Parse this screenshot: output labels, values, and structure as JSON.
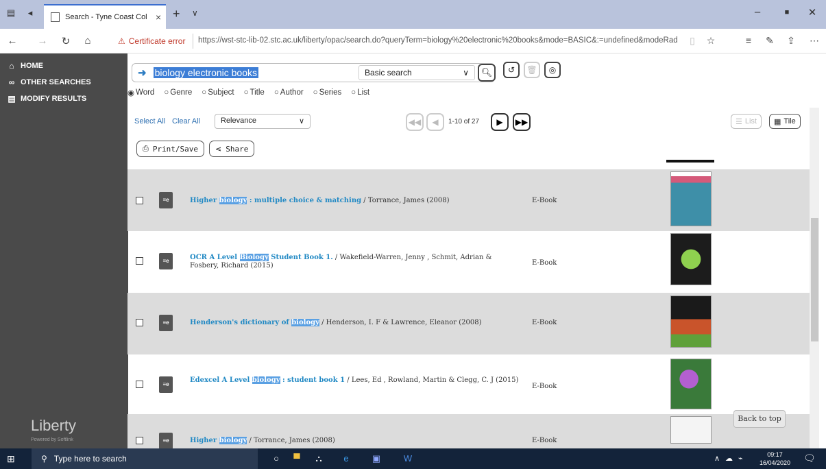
{
  "browser": {
    "tab_title": "Search - Tyne Coast Col",
    "tab_close": "×",
    "new_tab": "+",
    "certificate": "Certificate error",
    "url": "https://wst-stc-lib-02.stc.ac.uk/liberty/opac/search.do?queryTerm=biology%20electronic%20books&mode=BASIC&:=undefined&modeRad"
  },
  "sidebar": {
    "items": [
      {
        "label": "HOME",
        "icon": "home-icon"
      },
      {
        "label": "OTHER SEARCHES",
        "icon": "binoculars-icon"
      },
      {
        "label": "MODIFY RESULTS",
        "icon": "filter-icon"
      }
    ],
    "brand": "Liberty",
    "brand_sub": "Powered by Softlink"
  },
  "search": {
    "query": "biology electronic books",
    "mode": "Basic search",
    "radios": [
      "Word",
      "Genre",
      "Subject",
      "Title",
      "Author",
      "Series",
      "List"
    ],
    "selected_radio": "Word"
  },
  "toolbar": {
    "select_all": "Select All",
    "clear_all": "Clear All",
    "sort": "Relevance",
    "page_count": "1-10 of 27",
    "list_label": "List",
    "tile_label": "Tile",
    "print_label": "Print/Save",
    "share_label": "Share"
  },
  "results": [
    {
      "title_pre": "Higher ",
      "highlight": "biology",
      "title_post": " : multiple choice & matching",
      "author": " / Torrance, James  (2008)",
      "type": "E-Book"
    },
    {
      "title_pre": "OCR A Level ",
      "highlight": "Biology",
      "title_post": " Student Book 1.",
      "author": " / Wakefield-Warren, Jenny ,  Schmit, Adrian & Fosbery, Richard  (2015)",
      "type": "E-Book"
    },
    {
      "title_pre": "Henderson's dictionary of ",
      "highlight": "biology",
      "title_post": "",
      "author": " / Henderson, I. F & Lawrence, Eleanor  (2008)",
      "type": "E-Book"
    },
    {
      "title_pre": "Edexcel A Level ",
      "highlight": "biology",
      "title_post": " : student book 1",
      "author": " / Lees, Ed ,  Rowland, Martin & Clegg, C. J (2015)",
      "type": "E-Book"
    },
    {
      "title_pre": "Higher ",
      "highlight": "biology",
      "title_post": "",
      "author": " / Torrance, James  (2008)",
      "type": "E-Book"
    }
  ],
  "back_to_top": "Back to top",
  "taskbar": {
    "search_placeholder": "Type here to search",
    "time": "09:17",
    "date": "16/04/2020"
  }
}
